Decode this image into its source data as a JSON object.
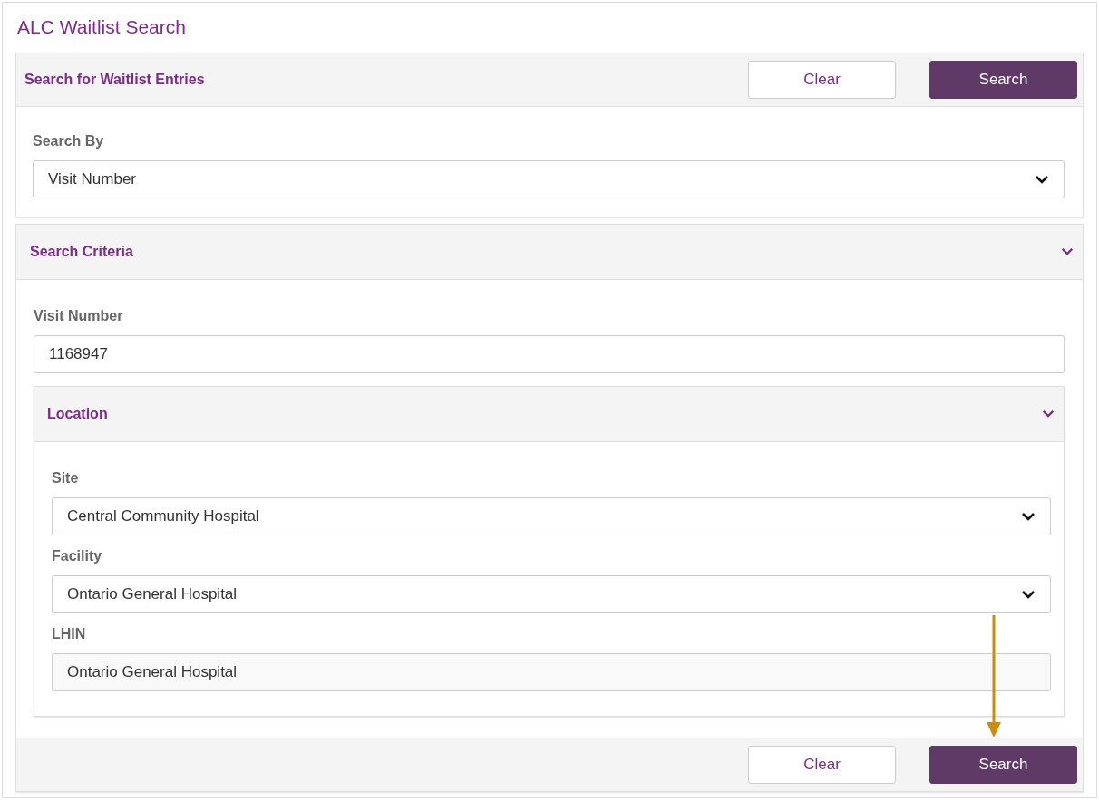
{
  "page_title": "ALC Waitlist Search",
  "search_panel": {
    "title": "Search for Waitlist Entries",
    "buttons": [
      {
        "label": "Clear",
        "kind": "secondary"
      },
      {
        "label": "Search",
        "kind": "primary"
      }
    ],
    "fields": [
      {
        "label": "Search By",
        "kind": "select",
        "value": "Visit Number"
      }
    ]
  },
  "criteria_panel": {
    "title": "Search Criteria",
    "expanded": true,
    "fields": [
      {
        "label": "Visit Number",
        "kind": "input",
        "value": "1168947"
      }
    ],
    "location": {
      "title": "Location",
      "expanded": true,
      "fields": [
        {
          "label": "Site",
          "kind": "select",
          "value": "Central Community Hospital"
        },
        {
          "label": "Facility",
          "kind": "select",
          "value": "Ontario General Hospital"
        },
        {
          "label": "LHIN",
          "kind": "readonly",
          "value": "Ontario General Hospital"
        }
      ]
    },
    "buttons": [
      {
        "label": "Clear",
        "kind": "secondary"
      },
      {
        "label": "Search",
        "kind": "primary"
      }
    ]
  }
}
